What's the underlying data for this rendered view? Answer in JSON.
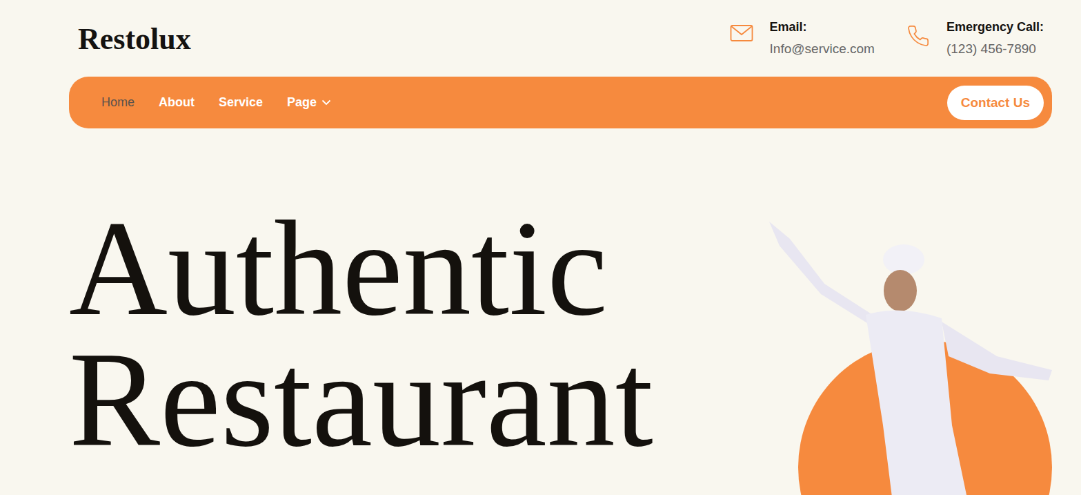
{
  "logo": "Restolux",
  "contacts": [
    {
      "kind": "email",
      "label": "Email:",
      "value": "Info@service.com"
    },
    {
      "kind": "phone",
      "label": "Emergency Call:",
      "value": "(123) 456-7890"
    }
  ],
  "nav": {
    "items": [
      {
        "label": "Home",
        "selected": true,
        "dropdown": false
      },
      {
        "label": "About",
        "selected": false,
        "dropdown": false
      },
      {
        "label": "Service",
        "selected": false,
        "dropdown": false
      },
      {
        "label": "Page",
        "selected": false,
        "dropdown": true
      }
    ],
    "cta": "Contact Us"
  },
  "hero": {
    "title_lines": [
      "Authentic",
      "Restaurant"
    ]
  }
}
